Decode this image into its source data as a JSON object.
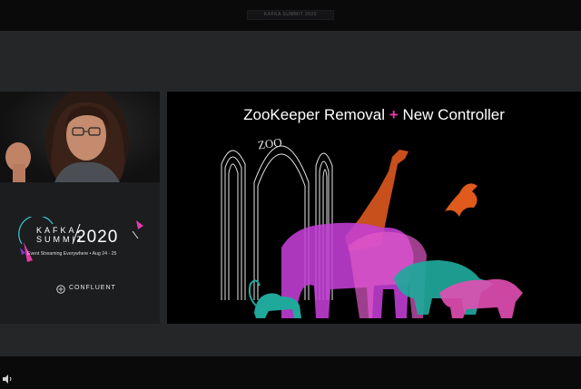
{
  "window": {
    "caption": "KAFKA SUMMIT 2020"
  },
  "brand": {
    "kafka": "KAFKA",
    "summit": "SUMMIT",
    "year": "2020",
    "tagline": "Event Streaming Everywhere • Aug 24 - 25",
    "company": "CONFLUENT"
  },
  "slide": {
    "title_left": "ZooKeeper Removal",
    "title_plus": "+",
    "title_right": "New Controller",
    "zoo_label": "ZOO"
  },
  "colors": {
    "accent_pink": "#e53ba7",
    "giraffe": "#d9571e",
    "elephant": "#c43fd6",
    "rhino": "#20a89b",
    "tiger": "#e24fb3",
    "bird": "#e05a1e"
  },
  "icons": {
    "volume": "volume-icon",
    "confluent": "confluent-logo-icon"
  }
}
